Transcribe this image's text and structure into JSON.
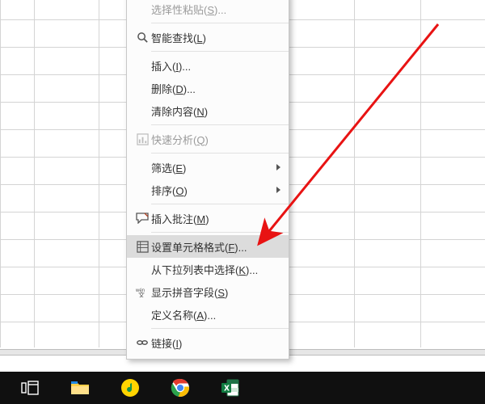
{
  "menu": {
    "items": [
      {
        "id": "paste-special",
        "label_pre": "选择性粘贴(",
        "hot": "S",
        "label_post": ")...",
        "icon": "",
        "disabled": true,
        "sep_after": true
      },
      {
        "id": "smart-lookup",
        "label_pre": "智能查找(",
        "hot": "L",
        "label_post": ")",
        "icon": "search",
        "sep_after": true
      },
      {
        "id": "insert",
        "label_pre": "插入(",
        "hot": "I",
        "label_post": ")...",
        "icon": "",
        "sep_after": false
      },
      {
        "id": "delete",
        "label_pre": "删除(",
        "hot": "D",
        "label_post": ")...",
        "icon": "",
        "sep_after": false
      },
      {
        "id": "clear-contents",
        "label_pre": "清除内容(",
        "hot": "N",
        "label_post": ")",
        "icon": "",
        "sep_after": true
      },
      {
        "id": "quick-analysis",
        "label_pre": "快速分析(",
        "hot": "Q",
        "label_post": ")",
        "icon": "quick",
        "disabled": true,
        "sep_after": true
      },
      {
        "id": "filter",
        "label_pre": "筛选(",
        "hot": "E",
        "label_post": ")",
        "icon": "",
        "submenu": true,
        "sep_after": false
      },
      {
        "id": "sort",
        "label_pre": "排序(",
        "hot": "O",
        "label_post": ")",
        "icon": "",
        "submenu": true,
        "sep_after": true
      },
      {
        "id": "insert-comment",
        "label_pre": "插入批注(",
        "hot": "M",
        "label_post": ")",
        "icon": "comment",
        "sep_after": true
      },
      {
        "id": "format-cells",
        "label_pre": "设置单元格格式(",
        "hot": "F",
        "label_post": ")...",
        "icon": "format",
        "hover": true,
        "sep_after": false
      },
      {
        "id": "pick-from-list",
        "label_pre": "从下拉列表中选择(",
        "hot": "K",
        "label_post": ")...",
        "icon": "",
        "sep_after": false
      },
      {
        "id": "show-pinyin",
        "label_pre": "显示拼音字段(",
        "hot": "S",
        "label_post": ")",
        "icon": "pinyin",
        "sep_after": false
      },
      {
        "id": "define-name",
        "label_pre": "定义名称(",
        "hot": "A",
        "label_post": ")...",
        "icon": "",
        "sep_after": true
      },
      {
        "id": "link",
        "label_pre": "链接(",
        "hot": "I",
        "label_post": ")",
        "icon": "link",
        "sep_after": false
      }
    ]
  },
  "taskbar": {
    "items": [
      "task-view",
      "file-explorer",
      "music",
      "chrome",
      "excel"
    ]
  }
}
